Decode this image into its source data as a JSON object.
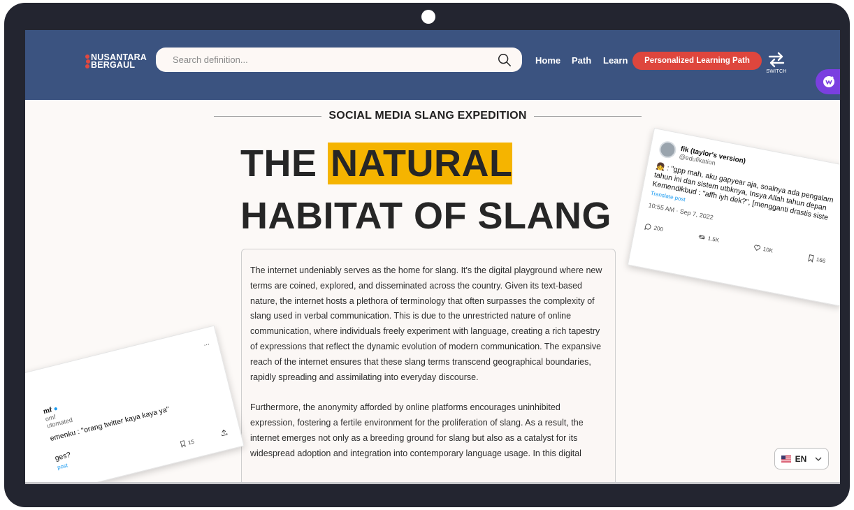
{
  "nav": {
    "logo_line1": "NUSANTARA",
    "logo_line2": "BERGAUL",
    "search_placeholder": "Search definition...",
    "links": [
      "Home",
      "Path",
      "Learn"
    ],
    "cta": "Personalized Learning Path",
    "switch_label": "SWITCH"
  },
  "hero": {
    "kicker": "SOCIAL MEDIA SLANG EXPEDITION",
    "title_plain": "THE ",
    "title_highlight": "NATURAL",
    "title_line2": "HABITAT OF SLANG"
  },
  "article": {
    "paragraphs": [
      "The internet undeniably serves as the home for slang. It's the digital playground where new terms are coined, explored, and disseminated across the country. Given its text-based nature, the internet hosts a plethora of terminology that often surpasses the complexity of slang used in verbal communication. This is due to the unrestricted nature of online communication, where individuals freely experiment with language, creating a rich tapestry of expressions that reflect the dynamic evolution of modern communication. The expansive reach of the internet ensures that these slang terms transcend geographical boundaries, rapidly spreading and assimilating into everyday discourse.",
      "Furthermore, the anonymity afforded by online platforms encourages uninhibited expression, fostering a fertile environment for the proliferation of slang. As a result, the internet emerges not only as a breeding ground for slang but also as a catalyst for its widespread adoption and integration into contemporary language usage. In this digital"
    ]
  },
  "tweet_right": {
    "name": "fik (taylor's version)",
    "handle": "@edufikation",
    "body": "👧 : \"gpp mah, aku gapyear aja, soalnya ada pengalam tahun ini dan sistem utbknya, Insya Allah tahun depan Kemendikbud : \"affh iyh dek?\", [mengganti drastis siste",
    "translate": "Translate post",
    "time": "10:55 AM · Sep 7, 2022",
    "replies": "200",
    "retweets": "1.5K",
    "likes": "10K",
    "bookmarks": "166"
  },
  "tweet_left": {
    "name": "mf",
    "handle": "omf",
    "tag": "utomated",
    "body": "emenku : \"orang twitter kaya kaya ya\"",
    "body2": "ges?",
    "link": "post",
    "bookmarks": "15",
    "menu": "..."
  },
  "language": {
    "code": "EN"
  }
}
